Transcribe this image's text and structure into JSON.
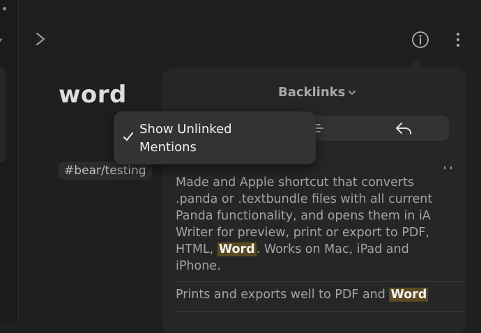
{
  "note": {
    "title": "word",
    "tag": "#bear/testing"
  },
  "popover": {
    "header": "Backlinks",
    "backlinks": [
      {
        "before": "Made and Apple shortcut that converts .panda or .textbundle files with all current Panda functionality, and opens them in iA Writer for preview, print or export to PDF, HTML, ",
        "highlight": "Word",
        "after": ". Works on Mac, iPad and iPhone."
      },
      {
        "before": "Prints and exports well to PDF and ",
        "highlight": "Word",
        "after": ""
      }
    ]
  },
  "menu": {
    "items": [
      {
        "label": "Show Unlinked Mentions",
        "checked": true
      }
    ]
  },
  "colors": {
    "background": "#1f1f1f",
    "popover": "#262626",
    "highlight": "#5b4a22"
  },
  "icons": [
    "forward-chevron-icon",
    "info-icon",
    "more-vertical-icon",
    "chevron-down-icon",
    "list-icon",
    "reply-icon",
    "checkmark-icon"
  ]
}
